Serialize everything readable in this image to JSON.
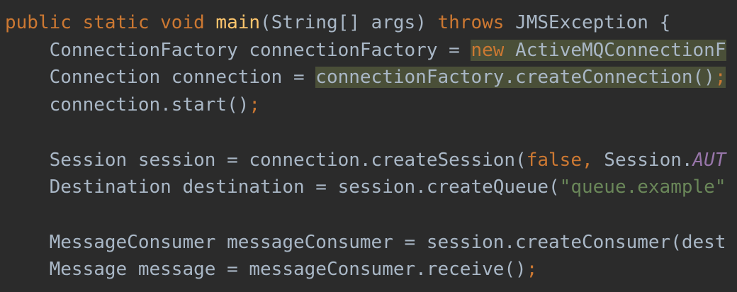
{
  "editor": {
    "colors": {
      "background": "#2b2b2b",
      "default": "#a9b7c6",
      "keyword": "#cc7832",
      "method_decl": "#ffc66d",
      "string": "#6a8759",
      "static_field": "#9876aa",
      "highlight": "#4a4f38"
    },
    "lines": [
      {
        "tokens": [
          {
            "t": "public static void ",
            "k": "keyword"
          },
          {
            "t": "main",
            "k": "method_decl"
          },
          {
            "t": "(String[] args) ",
            "k": "default"
          },
          {
            "t": "throws ",
            "k": "keyword"
          },
          {
            "t": "JMSException {",
            "k": "default"
          }
        ]
      },
      {
        "tokens": [
          {
            "t": "    ConnectionFactory connectionFactory = ",
            "k": "default"
          },
          {
            "t": "new",
            "k": "keyword",
            "hl": true
          },
          {
            "t": " ActiveMQConnectionF",
            "k": "default",
            "hl": true
          }
        ]
      },
      {
        "tokens": [
          {
            "t": "    Connection connection = ",
            "k": "default"
          },
          {
            "t": "connectionFactory.createConnection()",
            "k": "default",
            "hl": true
          },
          {
            "t": ";",
            "k": "keyword",
            "hl": true
          }
        ]
      },
      {
        "tokens": [
          {
            "t": "    connection.start()",
            "k": "default"
          },
          {
            "t": ";",
            "k": "keyword"
          }
        ]
      },
      {
        "tokens": []
      },
      {
        "tokens": [
          {
            "t": "    Session session = connection.createSession(",
            "k": "default"
          },
          {
            "t": "false, ",
            "k": "keyword"
          },
          {
            "t": "Session.",
            "k": "default"
          },
          {
            "t": "AUT",
            "k": "static_field",
            "italic": true
          }
        ]
      },
      {
        "tokens": [
          {
            "t": "    Destination destination = session.createQueue(",
            "k": "default"
          },
          {
            "t": "\"queue.example\"",
            "k": "string"
          }
        ]
      },
      {
        "tokens": []
      },
      {
        "tokens": [
          {
            "t": "    MessageConsumer messageConsumer = session.createConsumer(dest",
            "k": "default"
          }
        ]
      },
      {
        "tokens": [
          {
            "t": "    Message message = messageConsumer.receive()",
            "k": "default"
          },
          {
            "t": ";",
            "k": "keyword"
          }
        ]
      }
    ]
  }
}
